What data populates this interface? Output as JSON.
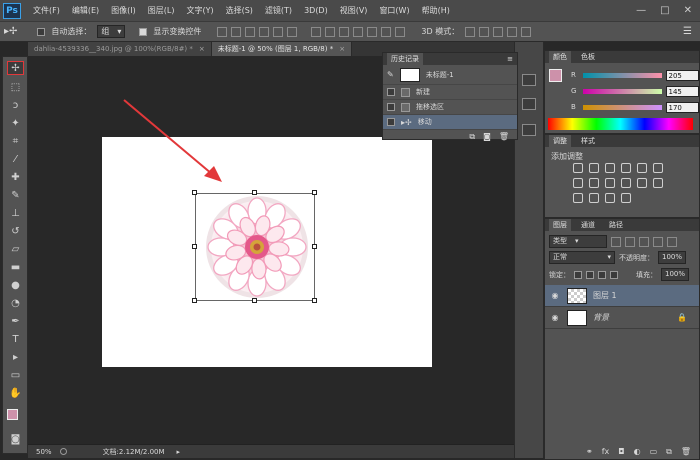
{
  "app": {
    "logo": "Ps"
  },
  "menu": [
    "文件(F)",
    "编辑(E)",
    "图像(I)",
    "图层(L)",
    "文字(Y)",
    "选择(S)",
    "滤镜(T)",
    "3D(D)",
    "视图(V)",
    "窗口(W)",
    "帮助(H)"
  ],
  "window_controls": {
    "minimize": "—",
    "maximize": "□",
    "close": "✕"
  },
  "options": {
    "auto_select_label": "自动选择：",
    "auto_select_value": "组",
    "show_transform_label": "显示变换控件",
    "mode_3d_label": "3D 模式：",
    "workspace_icon": "☰"
  },
  "tabs": [
    {
      "label": "dahlia-4539336__340.jpg @ 100%(RGB/8#) *",
      "close": "×"
    },
    {
      "label": "未标题-1 @ 50% (图层 1, RGB/8) *",
      "close": "×"
    }
  ],
  "history": {
    "tab": "历史记录",
    "snapshot": "未标题-1",
    "items": [
      "新建",
      "拖移选区",
      "移动"
    ]
  },
  "color_panel": {
    "tabs": [
      "颜色",
      "色板"
    ],
    "r_label": "R",
    "g_label": "G",
    "b_label": "B",
    "r": "205",
    "g": "145",
    "b": "170"
  },
  "adjust_panel": {
    "tabs": [
      "调整",
      "样式"
    ],
    "title": "添加调整"
  },
  "layers_panel": {
    "tabs": [
      "图层",
      "通道",
      "路径"
    ],
    "kind_label": "类型",
    "blend_mode": "正常",
    "opacity_label": "不透明度：",
    "opacity": "100%",
    "lock_label": "锁定：",
    "fill_label": "填充：",
    "fill": "100%",
    "layers": [
      {
        "name": "图层 1"
      },
      {
        "name": "背景"
      }
    ]
  },
  "status": {
    "zoom": "50%",
    "doc_info": "文档:2.12M/2.00M"
  },
  "colors": {
    "accent_red": "#e2383a",
    "foreground_swatch": "#cd91aa",
    "selection_blue": "#5b6b80"
  }
}
